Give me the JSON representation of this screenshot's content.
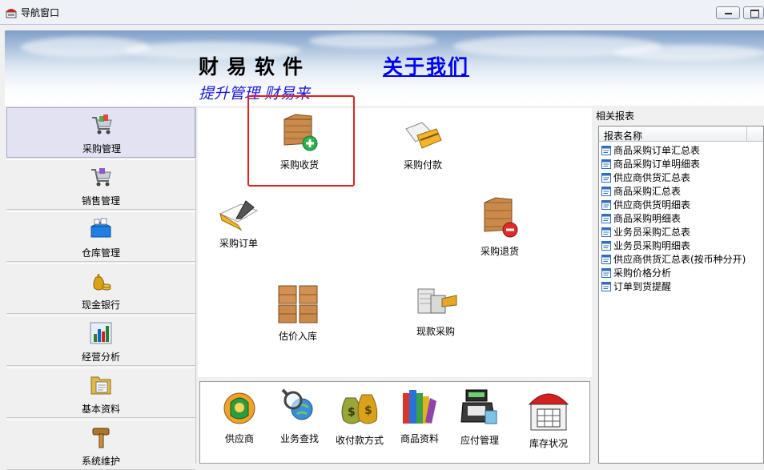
{
  "window": {
    "title": "导航窗口"
  },
  "banner": {
    "brand": "财易软件",
    "about": "关于我们",
    "slogan": "提升管理 财易来"
  },
  "sidebar": {
    "items": [
      {
        "label": "采购管理",
        "icon": "shopping-cart-icon",
        "selected": true
      },
      {
        "label": "销售管理",
        "icon": "sales-cart-icon"
      },
      {
        "label": "仓库管理",
        "icon": "warehouse-box-icon"
      },
      {
        "label": "现金银行",
        "icon": "money-bag-icon"
      },
      {
        "label": "经营分析",
        "icon": "bar-chart-icon"
      },
      {
        "label": "基本资料",
        "icon": "document-folder-icon"
      },
      {
        "label": "系统维护",
        "icon": "hammer-icon"
      }
    ]
  },
  "workspace": {
    "actions": [
      {
        "label": "采购收货",
        "icon": "goods-receipt-icon"
      },
      {
        "label": "采购付款",
        "icon": "payment-card-icon"
      },
      {
        "label": "采购订单",
        "icon": "purchase-order-icon"
      },
      {
        "label": "采购退货",
        "icon": "goods-return-icon"
      },
      {
        "label": "估价入库",
        "icon": "stacked-boxes-icon"
      },
      {
        "label": "现款采购",
        "icon": "cash-purchase-icon"
      }
    ]
  },
  "toolbar": {
    "items": [
      {
        "label": "供应商",
        "icon": "supplier-icon"
      },
      {
        "label": "业务查找",
        "icon": "magnifier-globe-icon"
      },
      {
        "label": "收付款方式",
        "icon": "money-bags-icon"
      },
      {
        "label": "商品资料",
        "icon": "books-icon"
      },
      {
        "label": "应付管理",
        "icon": "cash-register-icon"
      },
      {
        "label": "库存状况",
        "icon": "warehouse-icon"
      }
    ]
  },
  "reports": {
    "title": "相关报表",
    "column": "报表名称",
    "items": [
      "商品采购订单汇总表",
      "商品采购订单明细表",
      "供应商供货汇总表",
      "商品采购汇总表",
      "供应商供货明细表",
      "商品采购明细表",
      "业务员采购汇总表",
      "业务员采购明细表",
      "供应商供货汇总表(按币种分开)",
      "采购价格分析",
      "订单到货提醒"
    ]
  },
  "colors": {
    "highlight": "#e4201e",
    "link": "#0000ee",
    "slogan": "#1a1adb",
    "selected_bg": "#e2e2f3"
  }
}
